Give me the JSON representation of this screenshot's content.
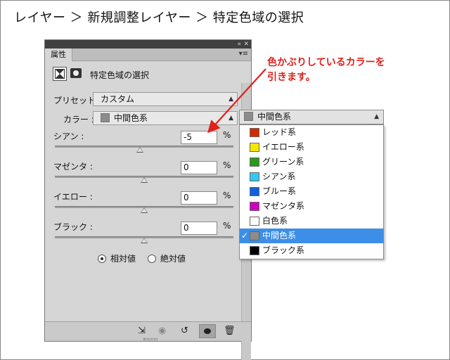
{
  "breadcrumb": "レイヤー ＞ 新規調整レイヤー ＞ 特定色域の選択",
  "panel": {
    "tab_label": "属性",
    "collapse_icon": "double-chevron-icon",
    "menu_icon": "panel-menu-icon",
    "adjustment_title": "特定色域の選択",
    "preset_label": "プリセット :",
    "preset_value": "カスタム",
    "colors_label": "カラー :",
    "colors_value": "中間色系",
    "colors_swatch": "#8c8c8c",
    "sliders": [
      {
        "label": "シアン :",
        "value": "-5",
        "unit": "%",
        "level": -5
      },
      {
        "label": "マゼンタ :",
        "value": "0",
        "unit": "%",
        "level": 0
      },
      {
        "label": "イエロー :",
        "value": "0",
        "unit": "%",
        "level": 0
      },
      {
        "label": "ブラック :",
        "value": "0",
        "unit": "%",
        "level": 0
      }
    ],
    "radio_relative": "相対値",
    "radio_absolute": "絶対値",
    "radio_selected": "relative"
  },
  "dropdown": {
    "header_value": "中間色系",
    "header_swatch": "#8c8c8c",
    "items": [
      {
        "label": "レッド系",
        "color": "#d42a00"
      },
      {
        "label": "イエロー系",
        "color": "#f5e800"
      },
      {
        "label": "グリーン系",
        "color": "#2a9a1a"
      },
      {
        "label": "シアン系",
        "color": "#35c8f0"
      },
      {
        "label": "ブルー系",
        "color": "#1060e0"
      },
      {
        "label": "マゼンタ系",
        "color": "#d000c0"
      },
      {
        "label": "白色系",
        "color": "#ffffff"
      },
      {
        "label": "中間色系",
        "color": "#8c8c8c",
        "selected": true
      },
      {
        "label": "ブラック系",
        "color": "#000000"
      }
    ]
  },
  "annotation": {
    "line1": "色かぶりしているカラーを",
    "line2": "引きます。",
    "color": "#e0201a"
  }
}
